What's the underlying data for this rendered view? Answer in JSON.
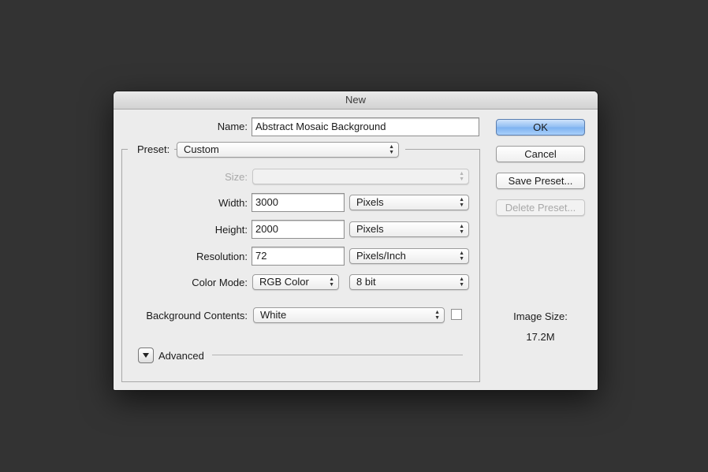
{
  "dialog": {
    "title": "New",
    "name_label": "Name:",
    "name_value": "Abstract Mosaic Background",
    "preset_label": "Preset:",
    "preset_value": "Custom",
    "size_label": "Size:",
    "size_value": "",
    "width_label": "Width:",
    "width_value": "3000",
    "width_unit": "Pixels",
    "height_label": "Height:",
    "height_value": "2000",
    "height_unit": "Pixels",
    "resolution_label": "Resolution:",
    "resolution_value": "72",
    "resolution_unit": "Pixels/Inch",
    "color_mode_label": "Color Mode:",
    "color_mode_value": "RGB Color",
    "bit_depth_value": "8 bit",
    "background_label": "Background Contents:",
    "background_value": "White",
    "background_swatch_color": "#ffffff",
    "advanced_label": "Advanced",
    "buttons": {
      "ok": "OK",
      "cancel": "Cancel",
      "save_preset": "Save Preset...",
      "delete_preset": "Delete Preset..."
    },
    "image_size_label": "Image Size:",
    "image_size_value": "17.2M"
  },
  "colors": {
    "backdrop": "#333333",
    "dialog_bg": "#ececec",
    "primary_button": "#8fbdf2"
  }
}
